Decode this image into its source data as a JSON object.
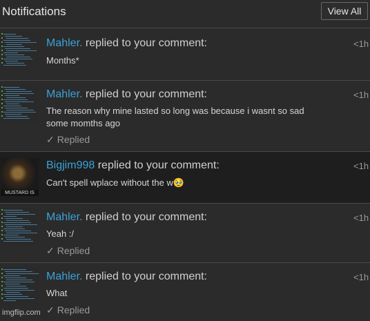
{
  "header": {
    "title": "Notifications",
    "view_all_label": "View All"
  },
  "notifications": [
    {
      "user": "Mahler.",
      "action": "replied to your comment:",
      "time": "<1h",
      "text": "Months*",
      "replied": ""
    },
    {
      "user": "Mahler.",
      "action": "replied to your comment:",
      "time": "<1h",
      "text": "The reason why mine lasted so long was because i wasnt so sad some momths ago",
      "replied": "Replied"
    },
    {
      "user": "Bigjim998",
      "action": "replied to your comment:",
      "time": "<1h",
      "text": "Can't spell wplace without the w🥹",
      "replied": "",
      "avatar_caption": "MUSTARD IS CO"
    },
    {
      "user": "Mahler.",
      "action": "replied to your comment:",
      "time": "<1h",
      "text": "Yeah :/",
      "replied": "Replied"
    },
    {
      "user": "Mahler.",
      "action": "replied to your comment:",
      "time": "<1h",
      "text": "What",
      "replied": "Replied"
    }
  ],
  "icons": {
    "check": "check-icon"
  },
  "colors": {
    "username": "#3aa3d8",
    "background": "#2b2b2b",
    "highlight": "#1e1e1e"
  },
  "watermark": "imgflip.com"
}
